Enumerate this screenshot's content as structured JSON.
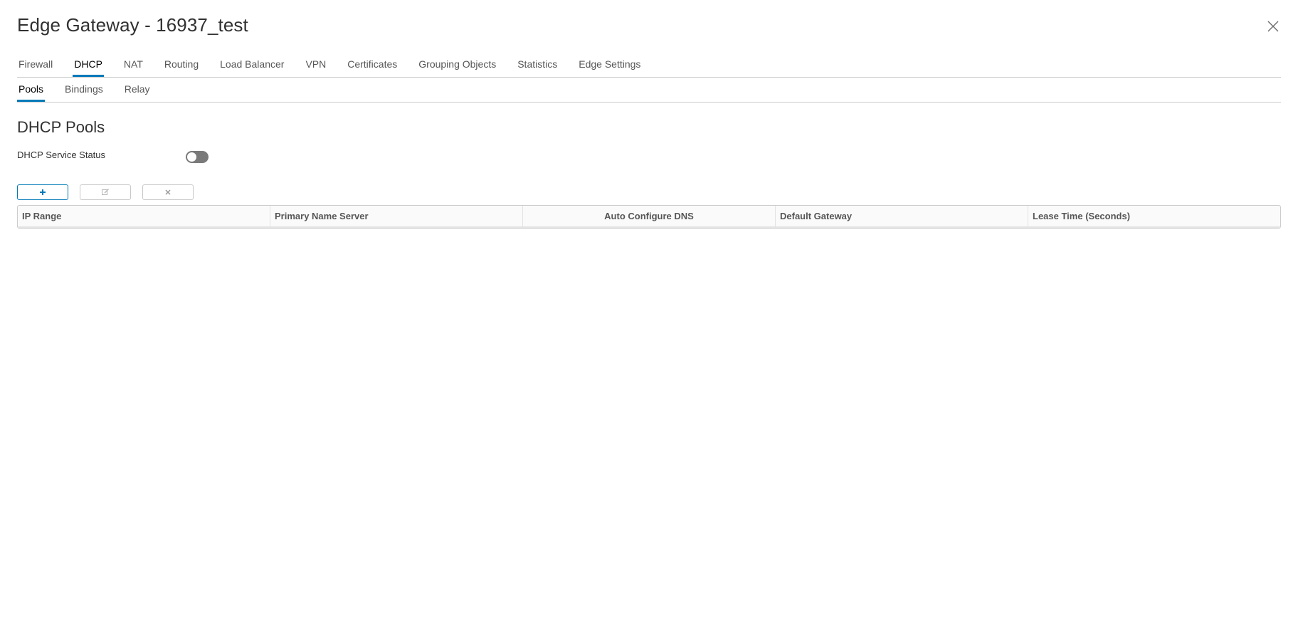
{
  "window": {
    "title": "Edge Gateway - 16937_test"
  },
  "tabs": [
    {
      "label": "Firewall",
      "active": false
    },
    {
      "label": "DHCP",
      "active": true
    },
    {
      "label": "NAT",
      "active": false
    },
    {
      "label": "Routing",
      "active": false
    },
    {
      "label": "Load Balancer",
      "active": false
    },
    {
      "label": "VPN",
      "active": false
    },
    {
      "label": "Certificates",
      "active": false
    },
    {
      "label": "Grouping Objects",
      "active": false
    },
    {
      "label": "Statistics",
      "active": false
    },
    {
      "label": "Edge Settings",
      "active": false
    }
  ],
  "subtabs": [
    {
      "label": "Pools",
      "active": true
    },
    {
      "label": "Bindings",
      "active": false
    },
    {
      "label": "Relay",
      "active": false
    }
  ],
  "section": {
    "title": "DHCP Pools",
    "service_status_label": "DHCP Service Status",
    "service_status_enabled": false
  },
  "toolbar": {
    "add_icon": "plus-icon",
    "edit_icon": "edit-icon",
    "delete_icon": "close-icon"
  },
  "grid": {
    "columns": [
      "IP Range",
      "Primary Name Server",
      "Auto Configure DNS",
      "Default Gateway",
      "Lease Time (Seconds)"
    ],
    "rows": []
  },
  "colors": {
    "accent": "#0079b8",
    "toggle_off": "#7a7a7a",
    "border": "#cccccc"
  }
}
